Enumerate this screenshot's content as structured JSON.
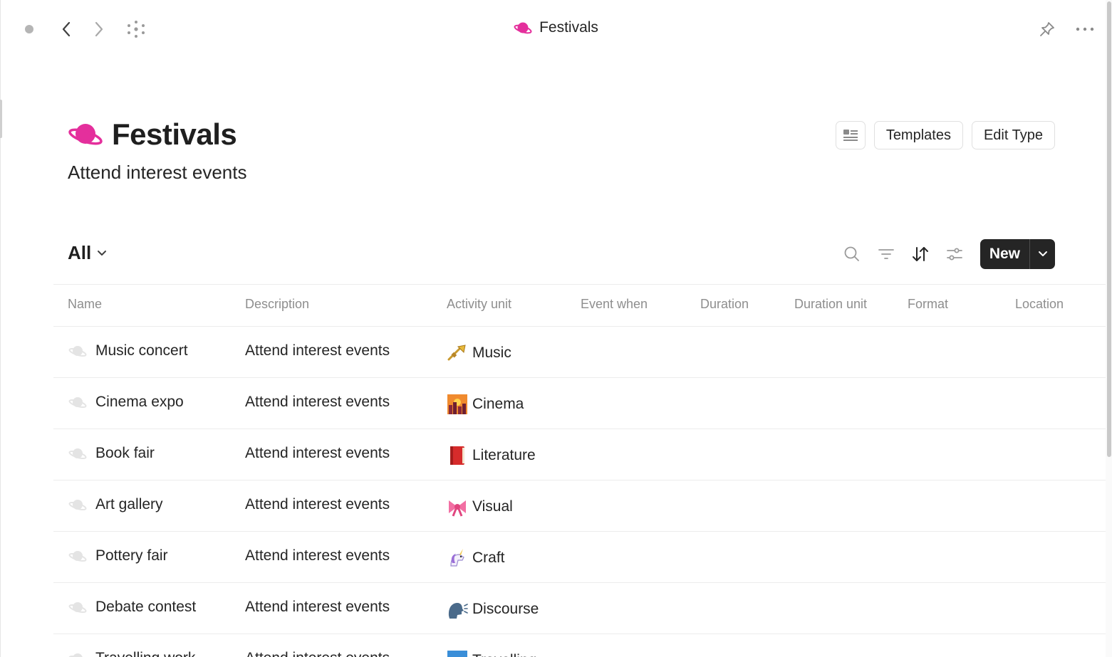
{
  "topbar": {
    "title": "Festivals"
  },
  "header": {
    "title": "Festivals",
    "subtitle": "Attend interest events",
    "templates_label": "Templates",
    "edit_type_label": "Edit Type"
  },
  "view": {
    "name": "All",
    "new_label": "New"
  },
  "colors": {
    "accent": "#e42f9c",
    "dark_button": "#252525",
    "muted_text": "#8e8e8e"
  },
  "table": {
    "columns": [
      "Name",
      "Description",
      "Activity unit",
      "Event when",
      "Duration",
      "Duration unit",
      "Format",
      "Location"
    ],
    "rows": [
      {
        "name": "Music concert",
        "description": "Attend interest events",
        "unit": "Music",
        "unit_icon": "trumpet-icon"
      },
      {
        "name": "Cinema expo",
        "description": "Attend interest events",
        "unit": "Cinema",
        "unit_icon": "cityscape-icon"
      },
      {
        "name": "Book fair",
        "description": "Attend interest events",
        "unit": "Literature",
        "unit_icon": "book-icon"
      },
      {
        "name": "Art gallery",
        "description": "Attend interest events",
        "unit": "Visual",
        "unit_icon": "ribbon-icon"
      },
      {
        "name": "Pottery fair",
        "description": "Attend interest events",
        "unit": "Craft",
        "unit_icon": "unicorn-icon"
      },
      {
        "name": "Debate contest",
        "description": "Attend interest events",
        "unit": "Discourse",
        "unit_icon": "speaking-head-icon"
      },
      {
        "name": "Travelling work",
        "description": "Attend interest events",
        "unit": "Travelling",
        "unit_icon": "travel-icon"
      }
    ]
  }
}
